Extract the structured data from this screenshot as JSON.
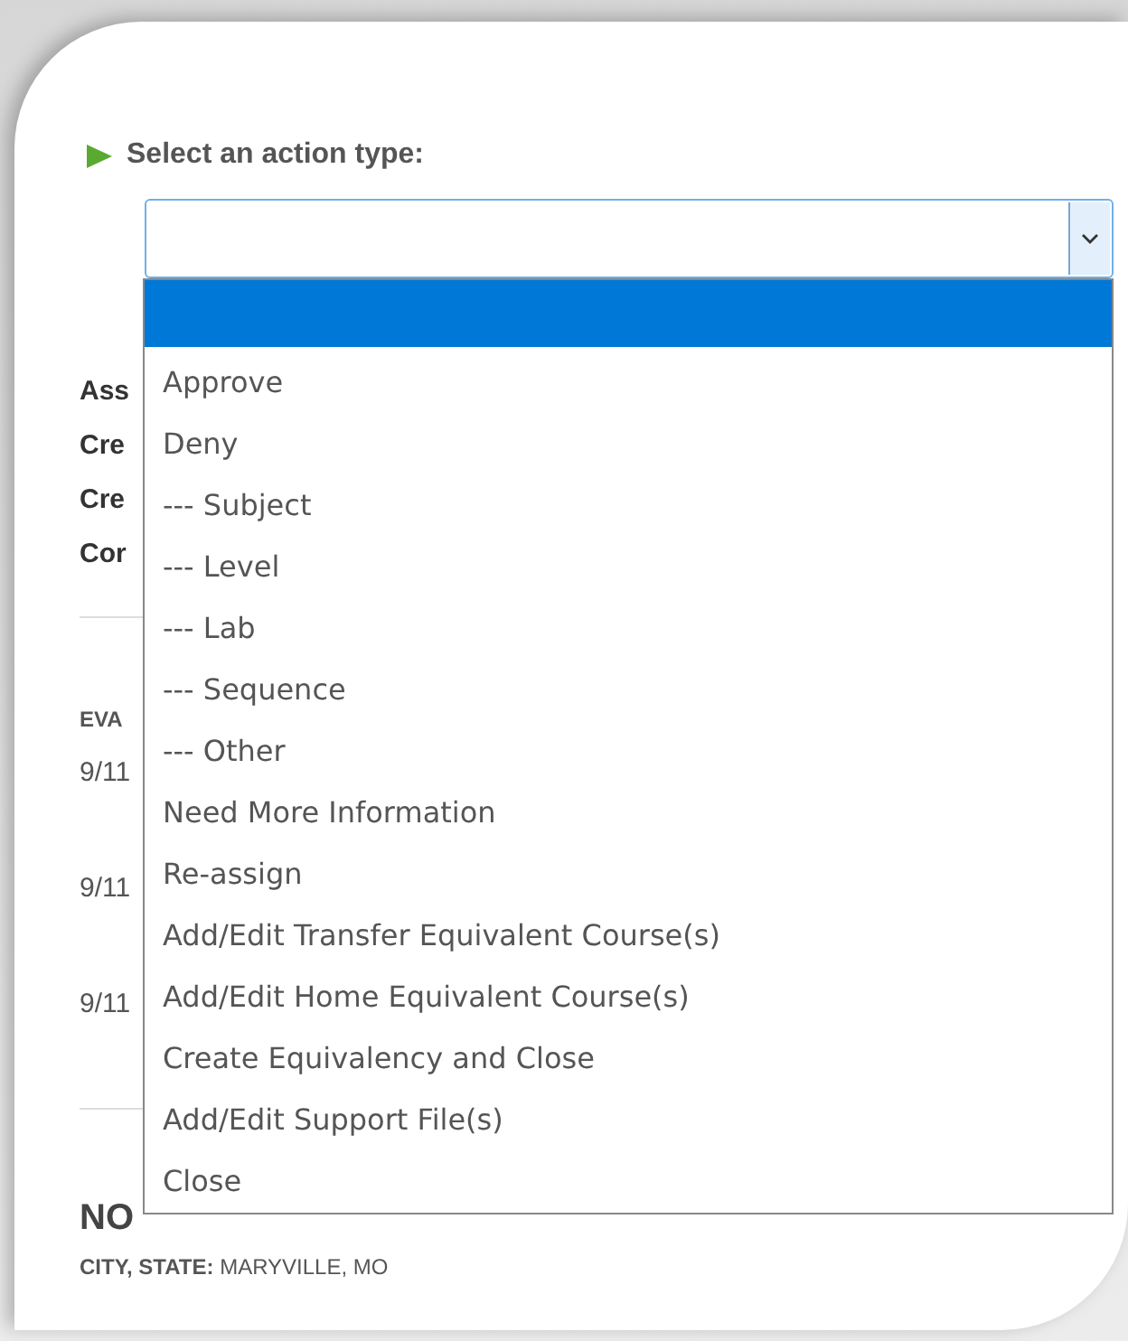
{
  "label": "Select an action type:",
  "select": {
    "options": [
      {
        "selected": true
      },
      {
        "label": "Approve",
        "selected": false
      },
      {
        "label": "Deny",
        "selected": false
      },
      {
        "label": "--- Subject",
        "selected": false
      },
      {
        "label": "--- Level",
        "selected": false
      },
      {
        "label": "--- Lab",
        "selected": false
      },
      {
        "label": "--- Sequence",
        "selected": false
      },
      {
        "label": "--- Other",
        "selected": false
      },
      {
        "label": "Need More Information",
        "selected": false
      },
      {
        "label": "Re-assign",
        "selected": false
      },
      {
        "label": "Add/Edit Transfer Equivalent Course(s)",
        "selected": false
      },
      {
        "label": "Add/Edit Home Equivalent Course(s)",
        "selected": false
      },
      {
        "label": "Create Equivalency and Close",
        "selected": false
      },
      {
        "label": "Add/Edit Support File(s)",
        "selected": false
      },
      {
        "label": "Close",
        "selected": false
      }
    ]
  },
  "background": {
    "rows": [
      {
        "kind": "field",
        "text": "Ass"
      },
      {
        "kind": "field",
        "text": "Cre"
      },
      {
        "kind": "field",
        "text": "Cre"
      },
      {
        "kind": "field",
        "text": "Cor"
      },
      {
        "kind": "heading",
        "text": "EVA"
      },
      {
        "kind": "date",
        "text": "9/11"
      },
      {
        "kind": "date",
        "text": "9/11"
      },
      {
        "kind": "date",
        "text": "9/11"
      },
      {
        "kind": "title",
        "text": "NO"
      },
      {
        "kind": "address",
        "text": "**CITY, STATE:** MARYVILLE, MO"
      }
    ]
  }
}
